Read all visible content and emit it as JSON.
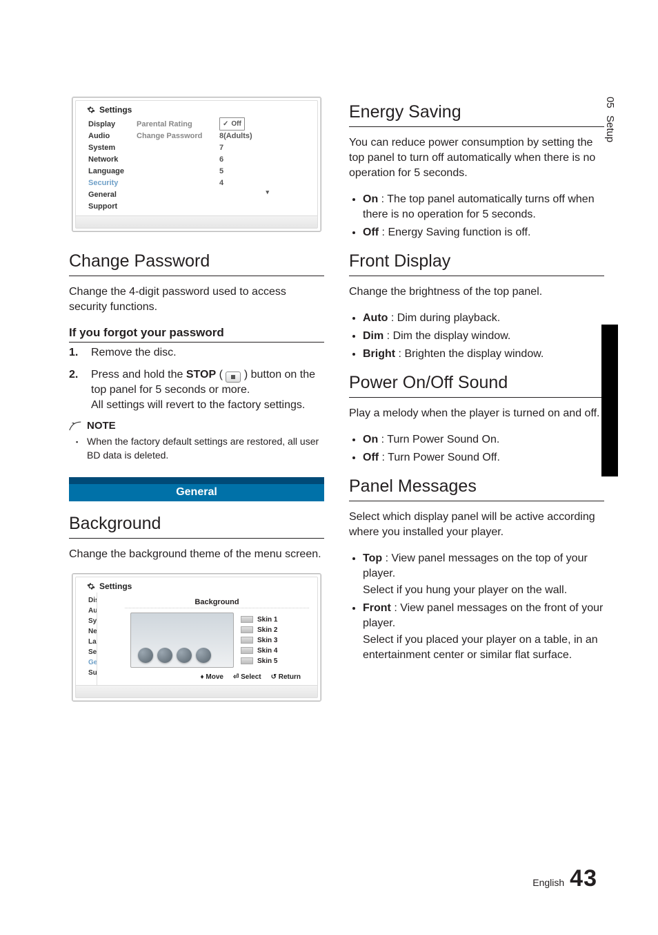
{
  "side": {
    "chapter": "05",
    "label": "Setup"
  },
  "panel1": {
    "title": "Settings",
    "sidebar": [
      "Display",
      "Audio",
      "System",
      "Network",
      "Language",
      "Security",
      "General",
      "Support"
    ],
    "sidebar_active": "Security",
    "menu": [
      "Parental Rating",
      "Change Password"
    ],
    "options": {
      "off": "Off",
      "o1": "8(Adults)",
      "o2": "7",
      "o3": "6",
      "o4": "5",
      "o5": "4"
    }
  },
  "change_password": {
    "heading": "Change Password",
    "body": "Change the 4-digit password used to access security functions.",
    "forgot_heading": "If you forgot your password",
    "step1": "Remove the disc.",
    "step2a": "Press and hold the ",
    "step2_stop": "STOP",
    "step2b": " button on the top panel for 5 seconds or more.",
    "step2c": "All settings will revert to the factory settings.",
    "note_label": "NOTE",
    "note1": "When the factory default settings are restored, all user BD data is deleted."
  },
  "general_bar": "General",
  "background": {
    "heading": "Background",
    "body": "Change the background theme of the menu screen."
  },
  "panel2": {
    "title": "Settings",
    "sidebar_trunc": [
      "Dis",
      "Au",
      "Sy",
      "Ne",
      "La",
      "Se",
      "Ge",
      "Su"
    ],
    "popup_title": "Background",
    "skins": [
      "Skin 1",
      "Skin 2",
      "Skin 3",
      "Skin 4",
      "Skin 5"
    ],
    "foot": {
      "move": "Move",
      "select": "Select",
      "return": "Return"
    }
  },
  "energy": {
    "heading": "Energy Saving",
    "body": "You can reduce power consumption by setting the top panel to turn off automatically when there is no operation for 5 seconds.",
    "on_lead": "On",
    "on_text": " : The top panel automatically turns off when there is no operation for 5 seconds.",
    "off_lead": "Off",
    "off_text": " : Energy Saving function is off."
  },
  "frontdisp": {
    "heading": "Front Display",
    "body": "Change the brightness of the top panel.",
    "auto_lead": "Auto",
    "auto_text": " : Dim during playback.",
    "dim_lead": "Dim",
    "dim_text": " : Dim the display window.",
    "bright_lead": "Bright",
    "bright_text": " : Brighten the display window."
  },
  "power": {
    "heading": "Power On/Off Sound",
    "body": "Play a melody when the player is turned on and off.",
    "on_lead": "On",
    "on_text": " : Turn Power Sound On.",
    "off_lead": "Off",
    "off_text": " : Turn Power Sound Off."
  },
  "panelmsg": {
    "heading": "Panel Messages",
    "body": "Select which display panel will be active according where you installed your player.",
    "top_lead": "Top",
    "top_text": " : View panel messages on the top of your player.",
    "top_sub": "Select if you hung your player on the wall.",
    "front_lead": "Front",
    "front_text": " : View panel messages on the front of your player.",
    "front_sub": "Select if you placed your player on a table, in an entertainment center or similar flat surface."
  },
  "footer": {
    "lang": "English",
    "page": "43"
  }
}
